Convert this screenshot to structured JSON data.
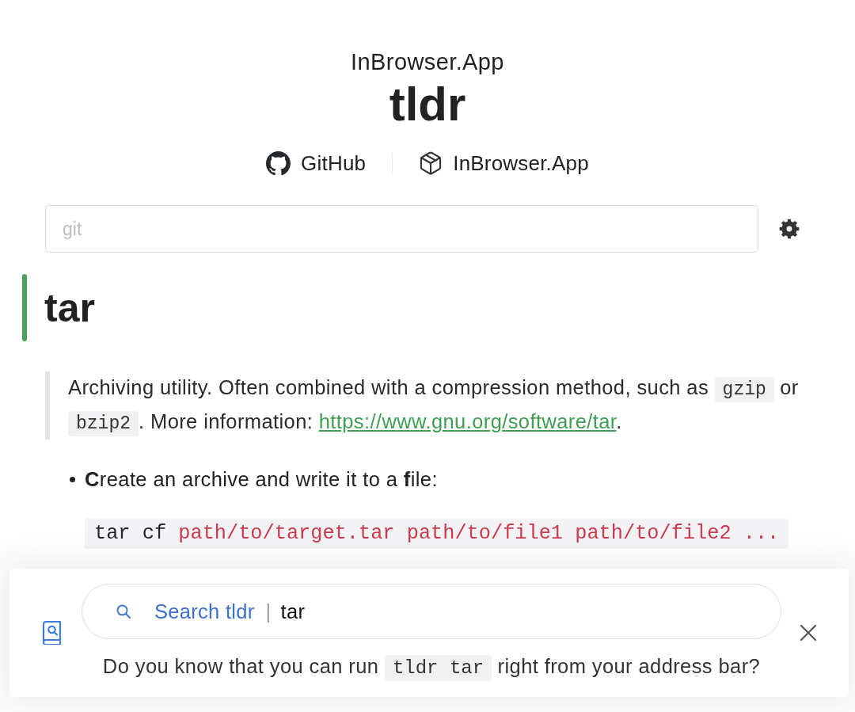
{
  "header": {
    "site_name": "InBrowser.App",
    "title": "tldr"
  },
  "links": [
    {
      "kind": "github",
      "label": "GitHub"
    },
    {
      "kind": "package",
      "label": "InBrowser.App"
    }
  ],
  "search": {
    "placeholder": "git"
  },
  "page": {
    "title": "tar",
    "description": [
      {
        "kind": "text",
        "text": "Archiving utility. Often combined with a compression method, such as "
      },
      {
        "kind": "code",
        "text": "gzip"
      },
      {
        "kind": "text",
        "text": " or "
      },
      {
        "kind": "code",
        "text": "bzip2"
      },
      {
        "kind": "text",
        "text": ". More information: "
      },
      {
        "kind": "link",
        "text": "https://www.gnu.org/software/tar"
      },
      {
        "kind": "text",
        "text": "."
      }
    ],
    "examples": [
      {
        "description": "**C**reate an archive and write it to a **f**ile:",
        "command": [
          {
            "kind": "plain",
            "text": "tar cf "
          },
          {
            "kind": "placeholder",
            "text": "path/to/target.tar path/to/file1 path/to/file2 ..."
          }
        ]
      }
    ]
  },
  "banner": {
    "search_label": "Search tldr",
    "separator": "|",
    "query": "tar",
    "hint": [
      {
        "kind": "text",
        "text": "Do you know that you can run "
      },
      {
        "kind": "code",
        "text": "tldr tar"
      },
      {
        "kind": "text",
        "text": " right from your address bar?"
      }
    ]
  }
}
